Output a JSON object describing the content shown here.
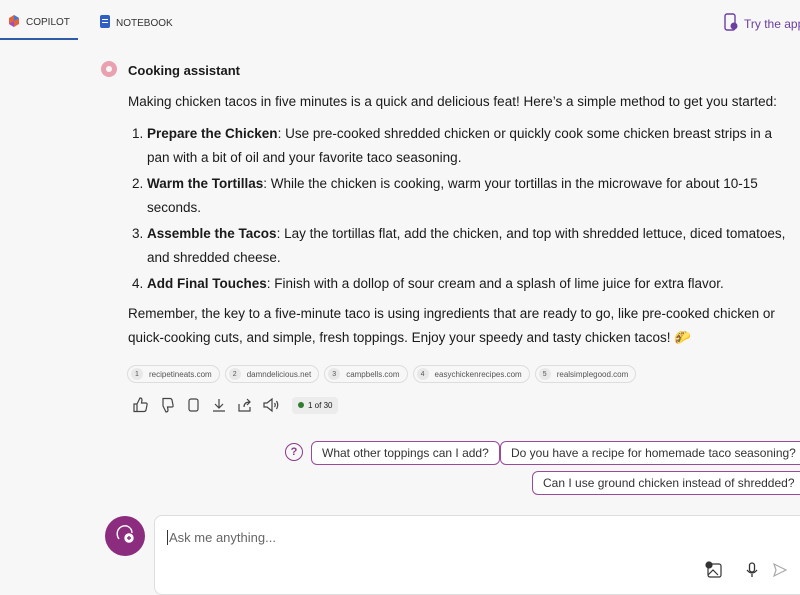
{
  "tabs": [
    {
      "label": "COPILOT",
      "icon": "copilot-icon",
      "active": true
    },
    {
      "label": "NOTEBOOK",
      "icon": "notebook-icon",
      "active": false
    }
  ],
  "try_app": {
    "label": "Try the app",
    "icon": "phone-icon"
  },
  "assistant": {
    "name": "Cooking assistant",
    "icon": "donut-icon"
  },
  "message": {
    "intro": "Making chicken tacos in five minutes is a quick and delicious feat! Here’s a simple method to get you started:",
    "steps": [
      {
        "title": "Prepare the Chicken",
        "text": ": Use pre-cooked shredded chicken or quickly cook some chicken breast strips in a pan with a bit of oil and your favorite taco seasoning."
      },
      {
        "title": "Warm the Tortillas",
        "text": ": While the chicken is cooking, warm your tortillas in the microwave for about 10-15 seconds."
      },
      {
        "title": "Assemble the Tacos",
        "text": ": Lay the tortillas flat, add the chicken, and top with shredded lettuce, diced tomatoes, and shredded cheese."
      },
      {
        "title": "Add Final Touches",
        "text": ": Finish with a dollop of sour cream and a splash of lime juice for extra flavor."
      }
    ],
    "outro": "Remember, the key to a five-minute taco is using ingredients that are ready to go, like pre-cooked chicken or quick-cooking cuts, and simple, fresh toppings. Enjoy your speedy and tasty chicken tacos! 🌮"
  },
  "citations": [
    {
      "n": "1",
      "site": "recipetineats.com"
    },
    {
      "n": "2",
      "site": "damndelicious.net"
    },
    {
      "n": "3",
      "site": "campbells.com"
    },
    {
      "n": "4",
      "site": "easychickenrecipes.com"
    },
    {
      "n": "5",
      "site": "realsimplegood.com"
    }
  ],
  "response_count": "1 of 30",
  "suggestions": [
    "What other toppings can I add?",
    "Do you have a recipe for homemade taco seasoning?",
    "Can I use ground chicken instead of shredded?"
  ],
  "input": {
    "placeholder": "Ask me anything..."
  },
  "colors": {
    "accent": "#8c2c7e",
    "tab_underline": "#2f5aa8"
  }
}
